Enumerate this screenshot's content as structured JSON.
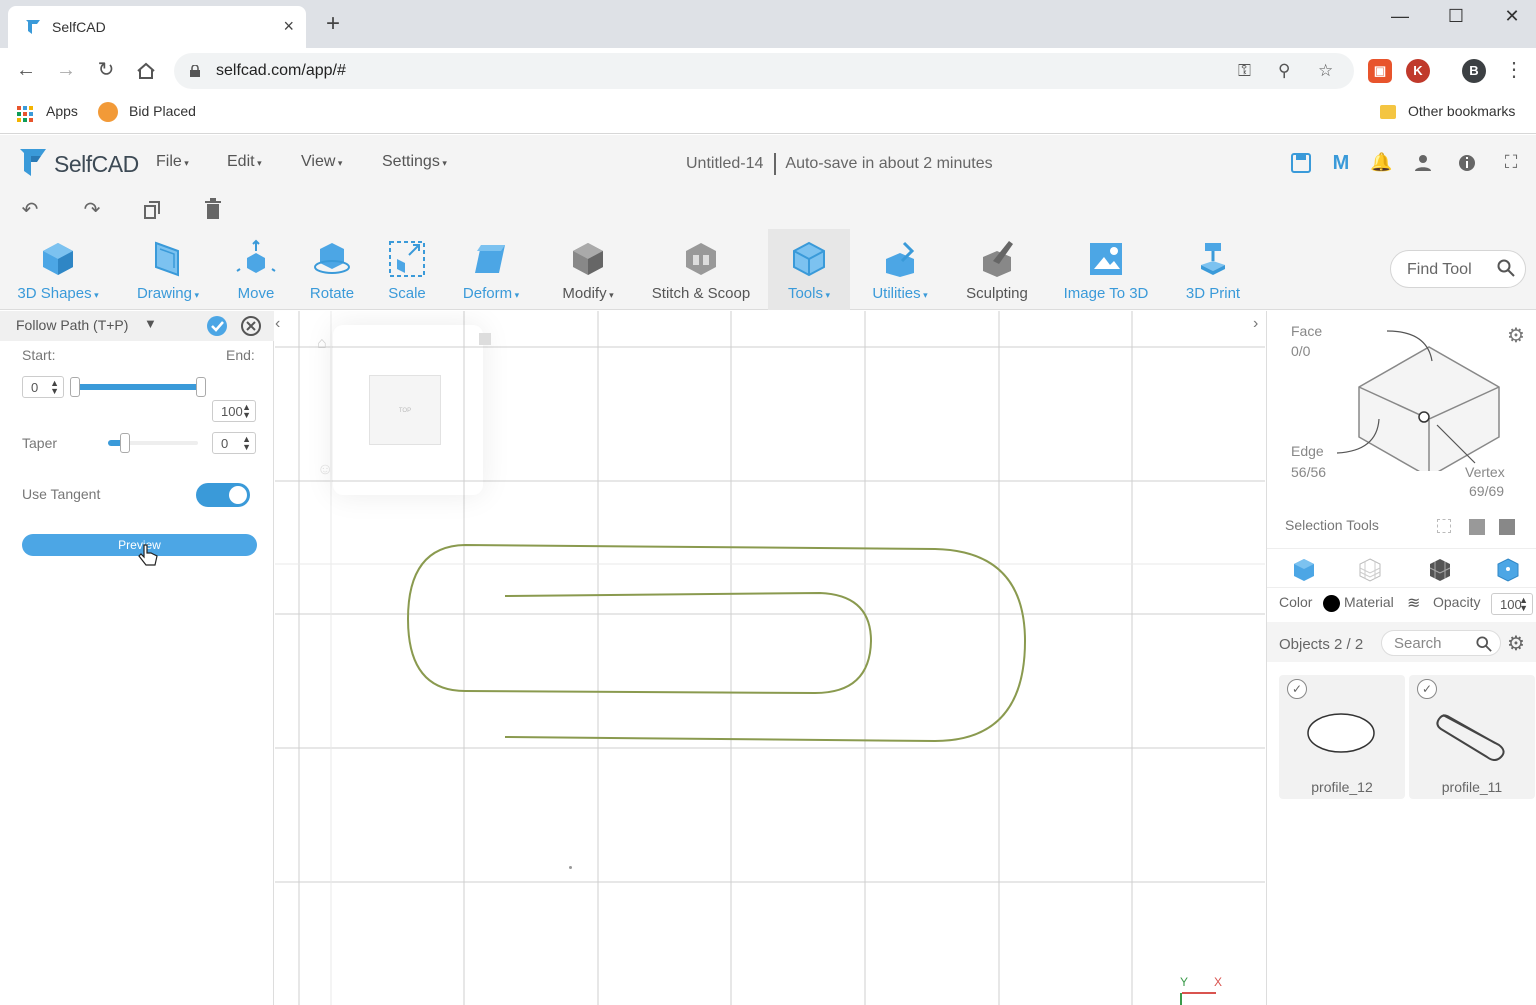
{
  "browser": {
    "tab_title": "SelfCAD",
    "tab_close": "×",
    "new_tab": "+",
    "win_minimize": "—",
    "win_maximize": "☐",
    "win_close": "✕",
    "url": "selfcad.com/app/#",
    "profile_initial": "B",
    "ext_initial": "K",
    "bookmarks": {
      "apps": "Apps",
      "bid_placed": "Bid Placed",
      "other": "Other bookmarks"
    }
  },
  "app": {
    "brand": "SelfCAD",
    "menus": [
      "File",
      "Edit",
      "View",
      "Settings"
    ],
    "doc_name": "Untitled-14",
    "autosave": "Auto-save in about 2 minutes"
  },
  "toolbar": {
    "tools": [
      {
        "label": "3D Shapes",
        "dropdown": true,
        "icon": "cube-icon"
      },
      {
        "label": "Drawing",
        "dropdown": true,
        "icon": "drawing-icon"
      },
      {
        "label": "Move",
        "dropdown": false,
        "icon": "move-icon"
      },
      {
        "label": "Rotate",
        "dropdown": false,
        "icon": "rotate-icon"
      },
      {
        "label": "Scale",
        "dropdown": false,
        "icon": "scale-icon"
      },
      {
        "label": "Deform",
        "dropdown": true,
        "icon": "deform-icon"
      },
      {
        "label": "Modify",
        "dropdown": true,
        "icon": "modify-icon"
      },
      {
        "label": "Stitch & Scoop",
        "dropdown": false,
        "icon": "stitch-scoop-icon"
      },
      {
        "label": "Tools",
        "dropdown": true,
        "icon": "tools-icon"
      },
      {
        "label": "Utilities",
        "dropdown": true,
        "icon": "utilities-icon"
      },
      {
        "label": "Sculpting",
        "dropdown": false,
        "icon": "sculpting-icon"
      },
      {
        "label": "Image To 3D",
        "dropdown": false,
        "icon": "image-to-3d-icon"
      },
      {
        "label": "3D Print",
        "dropdown": false,
        "icon": "3d-print-icon"
      }
    ],
    "find_tool_placeholder": "Find Tool"
  },
  "left_panel": {
    "title": "Follow Path (T+P)",
    "start_label": "Start:",
    "end_label": "End:",
    "start_value": "0",
    "end_value": "100",
    "taper_label": "Taper",
    "taper_value": "0",
    "use_tangent_label": "Use Tangent",
    "use_tangent_on": true,
    "preview_label": "Preview"
  },
  "viewport": {
    "view_cube_label": "TOP",
    "axis_y": "Y",
    "axis_x": "X"
  },
  "right_panel": {
    "face_label": "Face",
    "face_count": "0/0",
    "edge_label": "Edge",
    "edge_count": "56/56",
    "vertex_label": "Vertex",
    "vertex_count": "69/69",
    "selection_tools_label": "Selection Tools",
    "color_label": "Color",
    "material_label": "Material",
    "opacity_label": "Opacity",
    "opacity_value": "100",
    "objects_label": "Objects 2 / 2",
    "search_placeholder": "Search",
    "objects": [
      {
        "name": "profile_12",
        "checked": true
      },
      {
        "name": "profile_11",
        "checked": true
      }
    ]
  },
  "colors": {
    "accent": "#3a9ad9",
    "path_stroke": "#8a9a4f"
  }
}
